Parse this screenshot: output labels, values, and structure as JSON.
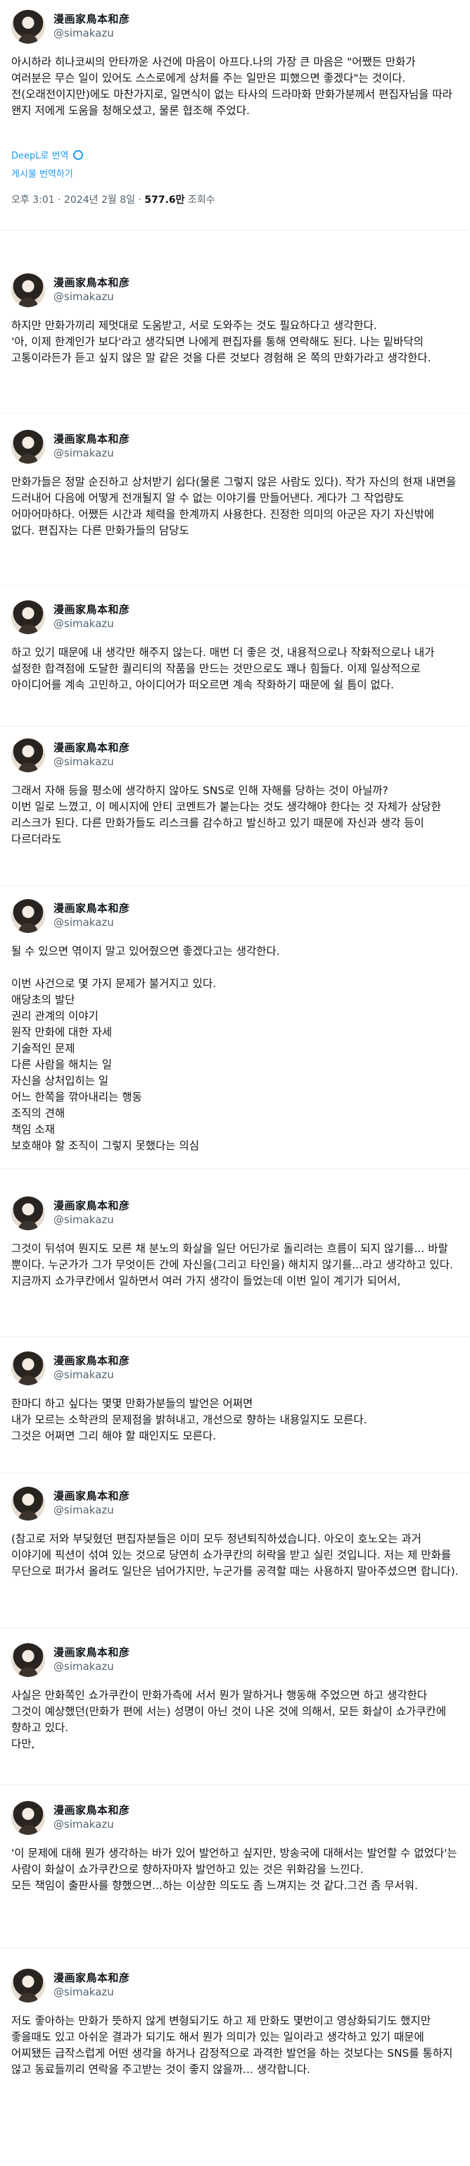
{
  "author": {
    "name": "漫画家鳥本和彦",
    "handle": "@simakazu"
  },
  "main_tweet": {
    "text": "아시하라 히나코씨의 안타까운 사건에 마음이 아프다.나의 가장 큰 마음은 \"어쨌든 만화가 여러분은 무슨 일이 있어도 스스로에게 상처를 주는 일만은 피했으면 좋겠다\"는 것이다.\n전(오래전이지만)에도 마찬가지로, 일면식이 없는 타사의 드라마화 만화가분께서 편집자님을 따라 왠지 저에게 도움을 청해오셨고, 물론 협조해 주었다.",
    "translated_by": "DeepL로 번역",
    "rate_translation": "게시물 번역하기",
    "time": "오후 3:01 · 2024년 2월 8일 · ",
    "views": "577.6만",
    "views_label": " 조회수"
  },
  "replies": [
    {
      "text": "하지만 만화가끼리 제멋대로 도움받고, 서로 도와주는 것도 필요하다고 생각한다.\n'아, 이제 한계인가 보다'라고 생각되면 나에게 편집자를 통해 연락해도 된다. 나는 밑바닥의 고통이라든가 듣고 싶지 않은 말 같은 것을 다른 것보다 경험해 온 쪽의 만화가라고 생각한다."
    },
    {
      "text": "만화가들은 정말 순진하고 상처받기 쉽다(물론 그렇지 않은 사람도 있다). 작가 자신의 현재 내면을 드러내어 다음에 어떻게 전개될지 알 수 없는 이야기를 만들어낸다. 게다가 그 작업량도 어마어마하다. 어쨌든 시간과 체력을 한계까지 사용한다. 진정한 의미의 아군은 자기 자신밖에 없다. 편집자는 다른 만화가들의 담당도"
    },
    {
      "text": "하고 있기 때문에 내 생각만 해주지 않는다. 매번 더 좋은 것, 내용적으로나 작화적으로나 내가 설정한 합격점에 도달한 퀄리티의 작품을 만드는 것만으로도 꽤나 힘들다. 이제 일상적으로 아이디어를 계속 고민하고, 아이디어가 떠오르면 계속 작화하기 때문에 쉴 틈이 없다."
    },
    {
      "text": "그래서 자해 등을 평소에 생각하지 않아도 SNS로 인해 자해를 당하는 것이 아닐까?\n이번 일로 느꼈고, 이 메시지에 안티 코멘트가 붙는다는 것도 생각해야 한다는 것 자체가 상당한 리스크가 된다. 다른 만화가들도 리스크를 감수하고 발신하고 있기 때문에 자신과 생각 등이 다르더라도"
    },
    {
      "text": "될 수 있으면 엮이지 말고 있어줬으면 좋겠다고는 생각한다.\n\n이번 사건으로 몇 가지 문제가 불거지고 있다.\n애당초의 발단\n권리 관계의 이야기\n원작 만화에 대한 자세\n기술적인 문제\n다른 사람을 해치는 일\n자신을 상처입히는 일\n어느 한쪽을 깎아내리는 행동\n조직의 견해\n책임 소재\n보호해야 할 조직이 그렇지 못했다는 의심"
    },
    {
      "text": "그것이 뒤섞여 뭔지도 모른 채 분노의 화살을 일단 어딘가로 돌리려는 흐름이 되지 않기를... 바랄 뿐이다. 누군가가 그가 무엇이든 간에 자신을(그리고 타인을) 해치지 않기를...라고 생각하고 있다. 지금까지 쇼가쿠칸에서 일하면서 여러 가지 생각이 들었는데 이번 일이 계기가 되어서,"
    },
    {
      "text": "한마디 하고 싶다는 몇몇 만화가분들의 발언은 어쩌면\n내가 모르는 소학관의 문제점을 밝혀내고, 개선으로 향하는 내용일지도 모른다.\n그것은 어쩌면 그리 해야 할 때인지도 모른다."
    },
    {
      "text": "(참고로 저와 부딪혔던 편집자분들은 이미 모두 정년퇴직하셨습니다. 아오이 호노오는 과거 이야기에 픽션이 섞여 있는 것으로 당연히 쇼가쿠칸의 허락을 받고 실린 것입니다. 저는 제 만화를 무단으로 퍼가서 올려도 일단은 넘어가지만, 누군가를 공격할 때는 사용하지 말아주셨으면 합니다)."
    },
    {
      "text": "사실은 만화쪽인 쇼가쿠칸이 만화가측에 서서 뭔가 말하거나 행동해 주었으면 하고 생각한다\n그것이 예상했던(만화가 편에 서는) 성명이 아닌 것이 나온 것에 의해서, 모든 화살이 쇼가쿠칸에 향하고 있다.\n다만,"
    },
    {
      "text": "'이 문제에 대해 뭔가 생각하는 바가 있어 발언하고 싶지만, 방송국에 대해서는 발언할 수 없었다'는 사람이 화살이 쇼가쿠칸으로 향하자마자 발언하고 있는 것은 위화감을 느낀다.\n모든 책임이 출판사를 향했으면...하는 이상한 의도도 좀 느껴지는 것 같다.그건 좀 무서워."
    },
    {
      "text": "저도 좋아하는 만화가 뜻하지 않게 변형되기도 하고 제 만화도 몇번이고 영상화되기도 했지만 좋을때도 있고 아쉬운 결과가 되기도 해서 뭔가 의미가 있는 일이라고 생각하고 있기 때문에\n어찌됐든 급작스럽게 어떤 생각을 하거나 감정적으로 과격한 발언을 하는 것보다는 SNS를 통하지 않고 동료들끼리 연락을 주고받는 것이 좋지 않을까... 생각합니다."
    }
  ]
}
